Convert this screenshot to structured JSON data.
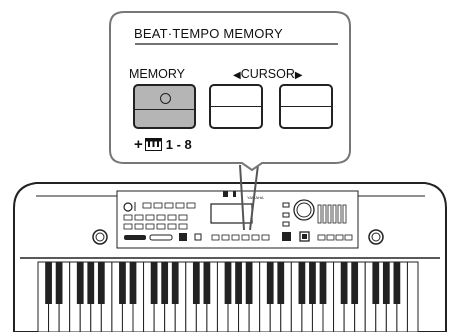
{
  "panel": {
    "title": "BEAT·TEMPO MEMORY",
    "memory_label": "MEMORY",
    "cursor_label": "CURSOR",
    "cursor_left_arrow": "◀",
    "cursor_right_arrow": "▶",
    "memory_combo_plus": "+",
    "memory_combo_range": "1 - 8"
  },
  "keyboard": {
    "brand": "YAMAHA"
  },
  "colors": {
    "outline": "#222222",
    "memory_button_fill": "#b5b5b5",
    "background": "#ffffff"
  },
  "icons": [
    "keyboard-keys-icon",
    "left-triangle-icon",
    "right-triangle-icon"
  ]
}
